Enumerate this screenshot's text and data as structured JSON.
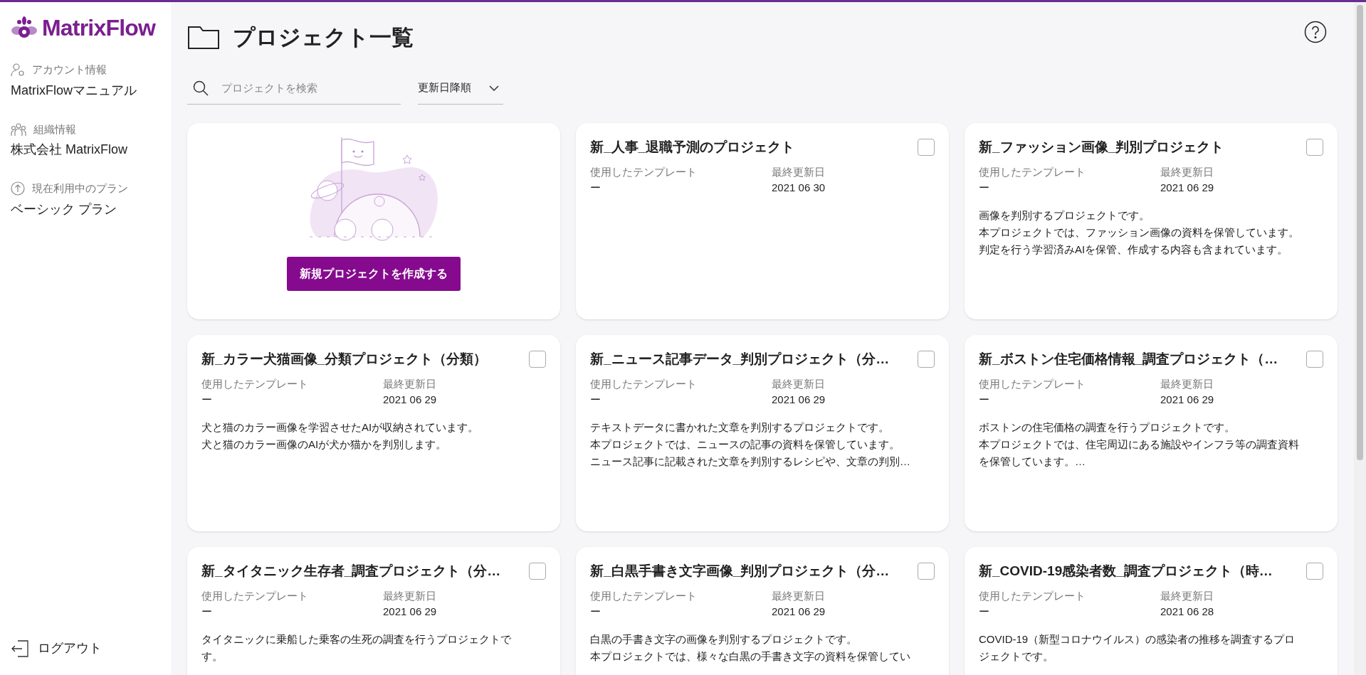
{
  "sidebar": {
    "logo": "MatrixFlow",
    "items": [
      {
        "kind": "account",
        "label": "アカウント情報",
        "value": "MatrixFlowマニュアル"
      },
      {
        "kind": "organization",
        "label": "組織情報",
        "value": "株式会社 MatrixFlow"
      },
      {
        "kind": "plan",
        "label": "現在利用中のプラン",
        "value": "ベーシック プラン"
      }
    ],
    "logout": "ログアウト"
  },
  "header": {
    "title": "プロジェクト一覧",
    "search": {
      "placeholder": "プロジェクトを検索"
    },
    "sort": "更新日降順"
  },
  "new_project_button": "新規プロジェクトを作成する",
  "projects": [
    {
      "title": "新_人事_退職予測のプロジェクト",
      "checked": false,
      "template_label": "使用したテンプレート",
      "template": "ー",
      "date_label": "最終更新日",
      "date": "2021 06 30"
    },
    {
      "title": "新_ファッション画像_判別プロジェクト",
      "checked": false,
      "template_label": "使用したテンプレート",
      "template": "ー",
      "date_label": "最終更新日",
      "date": "2021 06 29",
      "description": [
        "画像を判別するプロジェクトです。",
        "本プロジェクトでは、ファッション画像の資料を保管しています。",
        "判定を行う学習済みAIを保管、作成する内容も含まれています。"
      ]
    },
    {
      "title": "新_カラー犬猫画像_分類プロジェクト（分類）",
      "checked": false,
      "template_label": "使用したテンプレート",
      "template": "ー",
      "date_label": "最終更新日",
      "date": "2021 06 29",
      "description": [
        "犬と猫のカラー画像を学習させたAIが収納されています。",
        "犬と猫のカラー画像のAIが犬か猫かを判別します。"
      ]
    },
    {
      "title": "新_ニュース記事データ_判別プロジェクト（分…",
      "checked": false,
      "template_label": "使用したテンプレート",
      "template": "ー",
      "date_label": "最終更新日",
      "date": "2021 06 29",
      "description": [
        "テキストデータに書かれた文章を判別するプロジェクトです。",
        "本プロジェクトでは、ニュースの記事の資料を保管しています。",
        "ニュース記事に記載された文章を判別するレシピや、文章の判別…"
      ]
    },
    {
      "title": "新_ボストン住宅価格情報_調査プロジェクト（…",
      "checked": false,
      "template_label": "使用したテンプレート",
      "template": "ー",
      "date_label": "最終更新日",
      "date": "2021 06 29",
      "description": [
        "ボストンの住宅価格の調査を行うプロジェクトです。",
        "本プロジェクトでは、住宅周辺にある施設やインフラ等の調査資料",
        "を保管しています。…"
      ]
    },
    {
      "title": "新_タイタニック生存者_調査プロジェクト（分…",
      "checked": false,
      "template_label": "使用したテンプレート",
      "template": "ー",
      "date_label": "最終更新日",
      "date": "2021 06 29",
      "description": [
        "タイタニックに乗船した乗客の生死の調査を行うプロジェクトで",
        "す。"
      ]
    },
    {
      "title": "新_白黒手書き文字画像_判別プロジェクト（分…",
      "checked": false,
      "template_label": "使用したテンプレート",
      "template": "ー",
      "date_label": "最終更新日",
      "date": "2021 06 29",
      "description": [
        "白黒の手書き文字の画像を判別するプロジェクトです。",
        "本プロジェクトでは、様々な白黒の手書き文字の資料を保管してい"
      ]
    },
    {
      "title": "新_COVID-19感染者数_調査プロジェクト（時…",
      "checked": false,
      "template_label": "使用したテンプレート",
      "template": "ー",
      "date_label": "最終更新日",
      "date": "2021 06 28",
      "description": [
        "COVID-19（新型コロナウイルス）の感染者の推移を調査するプロ",
        "ジェクトです。"
      ]
    }
  ]
}
